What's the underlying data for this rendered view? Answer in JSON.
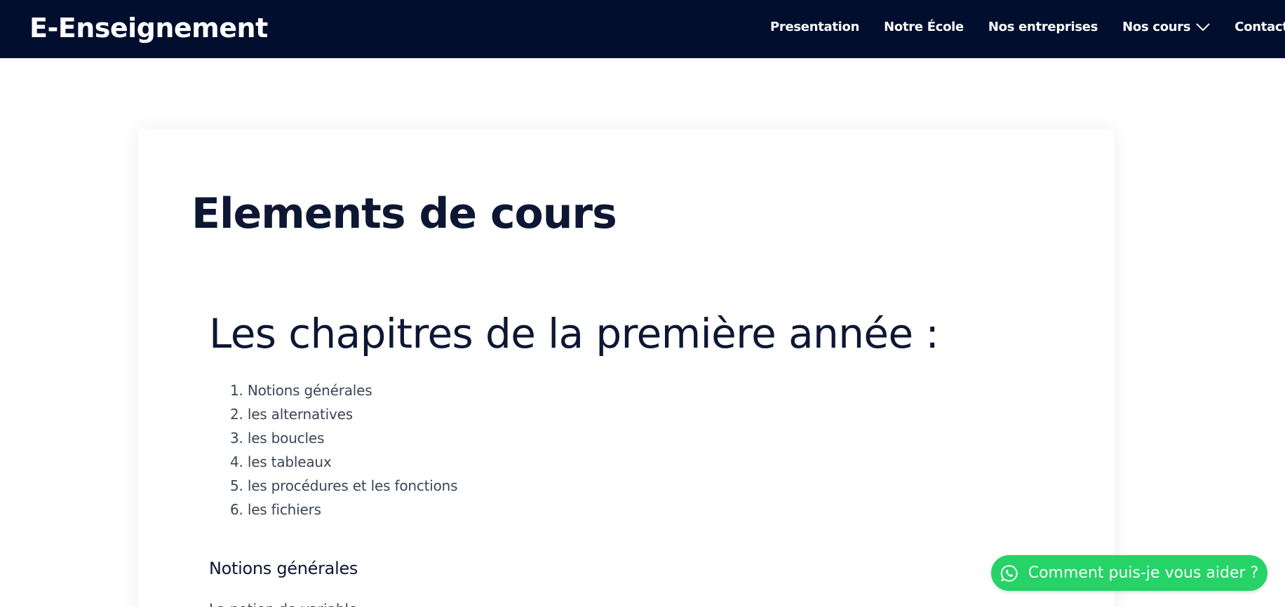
{
  "header": {
    "brand": "E-Enseignement",
    "nav": {
      "presentation": "Presentation",
      "ecole": "Notre École",
      "entreprises": "Nos entreprises",
      "cours": "Nos cours",
      "contact": "Contact"
    },
    "icons": {
      "cours_dropdown": "chevron-down-icon"
    }
  },
  "main": {
    "title": "Elements de cours",
    "section_heading": "Les chapitres de la première année :",
    "chapters": [
      "1. Notions générales",
      "2. les alternatives",
      "3. les boucles",
      "4. les tableaux",
      "5. les procédures et les fonctions",
      "6. les fichiers"
    ],
    "subheading": "Notions générales",
    "next_line_partial": "La notion de variable"
  },
  "help_widget": {
    "label": "Comment puis-je vous aider ?",
    "icon": "whatsapp-icon",
    "color": "#25d366"
  },
  "colors": {
    "navbar": "#020e2e",
    "heading": "#0d1733",
    "body_text": "#3a4656",
    "background": "#ffffff"
  }
}
